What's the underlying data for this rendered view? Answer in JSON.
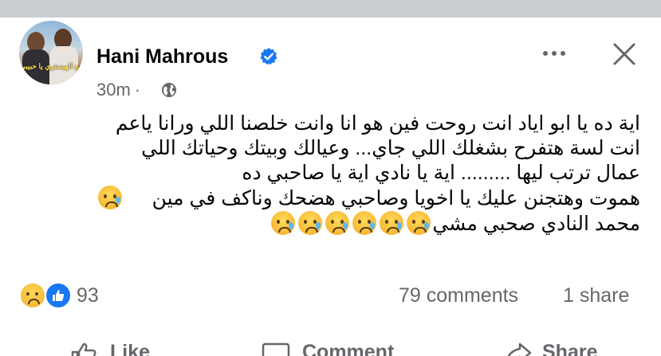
{
  "post": {
    "author": "Hani Mahrous",
    "verified": true,
    "time": "30m",
    "separator": "·",
    "audience_icon": "globe-icon",
    "avatar_caption": "مع الهيستري يا حبيبي",
    "body_lines": [
      "اية ده يا ابو اياد انت روحت فين هو انا وانت خلصنا اللي ورانا ياعم",
      "انت لسة هتفرح بشغلك اللي جاي... وعيالك وبيتك وحياتك اللي",
      "عمال ترتب ليها ......... اية يا نادي اية يا صاحبي ده",
      "هموت وهتجنن عليك يا اخويا وصاحبي هضحك وناكف في مين",
      "محمد النادي صحبي مشي"
    ]
  },
  "stats": {
    "reaction_icons": [
      "sad-icon",
      "like-icon"
    ],
    "reaction_count": "93",
    "comments": "79 comments",
    "shares": "1 share"
  },
  "actions": {
    "like": "Like",
    "comment": "Comment",
    "share": "Share"
  },
  "colors": {
    "verified": "#1877f2",
    "secondary_text": "#65676b",
    "top_bar": "#c9ccd1"
  }
}
